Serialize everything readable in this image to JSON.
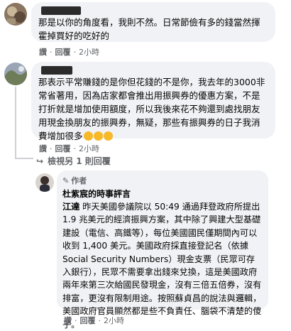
{
  "comments": [
    {
      "text": "那是以你的角度看，我則不然。日常節儉有多的錢當然揮霍掉買好的吃好的",
      "actions": {
        "like": "讚",
        "reply": "回覆",
        "time": "2小時"
      }
    },
    {
      "text": "那表示平常賺錢的是你但花錢的不是你，我去年的3000非常省著用，因為店家都會推出用振興券的優惠方案，不是打折就是增加使用額度，所以我後來花不夠還到處找朋友用現金換朋友的振興券，無疑，那些有振興券的日子我消費增加很多",
      "actions": {
        "like": "讚",
        "reply": "回覆",
        "time": "2小時"
      }
    }
  ],
  "view_replies": "檢視另 1 則回覆",
  "author_reply": {
    "badge": "作者",
    "name": "杜紫宸的時事評言",
    "mention": "江達",
    "text": " 昨天美國參議院以 50:49 通過拜登政府所提出 1.9 兆美元的經濟振興方案，其中除了興建大型基礎建設（電信、高鐵等），每位美國國民僅期間內可以收到 1,400 美元。美國政府採直接登記名（依據 Social Security Numbers）現金支票（民眾可存入銀行），民眾不需要拿出錢來兌換，這是美國政府兩年來第三次給國民發現金，沒有三倍五倍券，沒有排富，更沒有限制用途。按照蘇貞昌的說法與邏輯，美國政府官員顯然都是些不負責任、腦袋不清楚的傻子。",
    "actions": {
      "like": "讚",
      "reply": "回覆",
      "time": "2小時"
    }
  }
}
